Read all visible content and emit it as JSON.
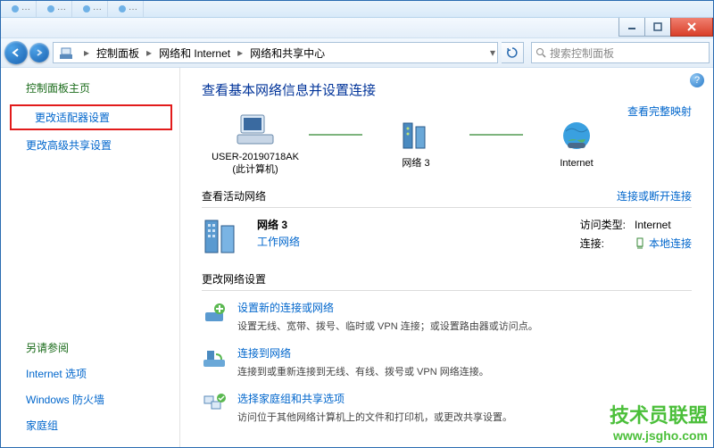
{
  "window_controls": {
    "min": "–",
    "max": "□",
    "close": "×"
  },
  "breadcrumb": {
    "items": [
      "控制面板",
      "网络和 Internet",
      "网络和共享中心"
    ]
  },
  "search": {
    "placeholder": "搜索控制面板"
  },
  "sidebar": {
    "home": "控制面板主页",
    "links": [
      "更改适配器设置",
      "更改高级共享设置"
    ],
    "see_also_title": "另请参阅",
    "see_also": [
      "Internet 选项",
      "Windows 防火墙",
      "家庭组"
    ]
  },
  "content": {
    "heading": "查看基本网络信息并设置连接",
    "map_link": "查看完整映射",
    "nodes": {
      "computer": {
        "name": "USER-20190718AK",
        "sub": "(此计算机)"
      },
      "network": {
        "name": "网络  3"
      },
      "internet": {
        "name": "Internet"
      }
    },
    "active_title": "查看活动网络",
    "active_link": "连接或断开连接",
    "active": {
      "name": "网络  3",
      "type": "工作网络",
      "access_label": "访问类型:",
      "access_value": "Internet",
      "conn_label": "连接:",
      "conn_value": "本地连接"
    },
    "settings_title": "更改网络设置",
    "settings": [
      {
        "title": "设置新的连接或网络",
        "desc": "设置无线、宽带、拨号、临时或 VPN 连接；或设置路由器或访问点。"
      },
      {
        "title": "连接到网络",
        "desc": "连接到或重新连接到无线、有线、拨号或 VPN 网络连接。"
      },
      {
        "title": "选择家庭组和共享选项",
        "desc": "访问位于其他网络计算机上的文件和打印机，或更改共享设置。"
      }
    ]
  },
  "watermark": {
    "text": "技术员联盟",
    "url": "www.jsgho.com"
  }
}
